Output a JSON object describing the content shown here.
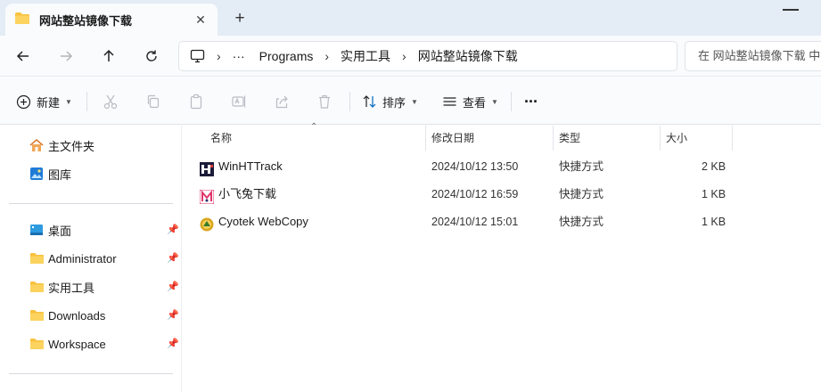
{
  "tab": {
    "title": "网站整站镜像下载",
    "close": "✕",
    "new_tab": "+"
  },
  "address": {
    "ellipsis": "···",
    "separator": "›",
    "segments": [
      "Programs",
      "实用工具",
      "网站整站镜像下载"
    ]
  },
  "search": {
    "placeholder": "在 网站整站镜像下载 中搜索"
  },
  "commands": {
    "new_label": "新建",
    "sort_label": "排序",
    "view_label": "查看",
    "more": "···"
  },
  "sidebar": {
    "top": [
      {
        "label": "主文件夹",
        "icon": "home-icon"
      },
      {
        "label": "图库",
        "icon": "gallery-icon"
      }
    ],
    "pinned": [
      {
        "label": "桌面",
        "icon": "desktop-icon"
      },
      {
        "label": "Administrator",
        "icon": "folder-icon"
      },
      {
        "label": "实用工具",
        "icon": "folder-icon"
      },
      {
        "label": "Downloads",
        "icon": "folder-icon"
      },
      {
        "label": "Workspace",
        "icon": "folder-icon"
      }
    ],
    "pin_glyph": "📌"
  },
  "columns": {
    "name": "名称",
    "date": "修改日期",
    "type": "类型",
    "size": "大小"
  },
  "files": [
    {
      "name": "WinHTTrack",
      "date": "2024/10/12 13:50",
      "type": "快捷方式",
      "size": "2 KB",
      "icon": "winhttrack-icon"
    },
    {
      "name": "小飞兔下载",
      "date": "2024/10/12 16:59",
      "type": "快捷方式",
      "size": "1 KB",
      "icon": "xiaofeitu-icon"
    },
    {
      "name": "Cyotek WebCopy",
      "date": "2024/10/12 15:01",
      "type": "快捷方式",
      "size": "1 KB",
      "icon": "webcopy-icon"
    }
  ],
  "colors": {
    "accent": "#0067c0",
    "folder": "#f8c13f",
    "titlebar": "#e4ecf5"
  }
}
